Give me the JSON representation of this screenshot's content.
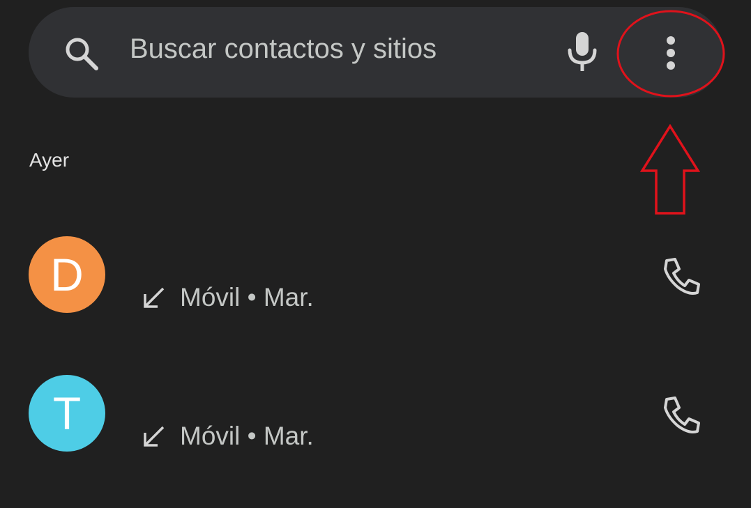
{
  "search": {
    "placeholder": "Buscar contactos y sitios",
    "icons": {
      "search": "search-icon",
      "mic": "microphone-icon",
      "more": "more-vertical-icon"
    }
  },
  "annotations": {
    "highlight": "red-ellipse-around-more-button",
    "pointer": "red-up-arrow",
    "color": "#e0121b"
  },
  "recents": {
    "section_label": "Ayer",
    "items": [
      {
        "initial": "D",
        "avatar_color": "#f49145",
        "detail": "Móvil • Mar.",
        "call_direction_icon": "incoming-call-arrow-icon",
        "action_icon": "phone-icon"
      },
      {
        "initial": "T",
        "avatar_color": "#4ecde6",
        "detail": "Móvil • Mar.",
        "call_direction_icon": "incoming-call-arrow-icon",
        "action_icon": "phone-icon"
      }
    ]
  },
  "colors": {
    "background": "#202020",
    "searchbar": "#303134",
    "text_primary": "#e3e3e3",
    "text_secondary": "#c4c7c5"
  }
}
